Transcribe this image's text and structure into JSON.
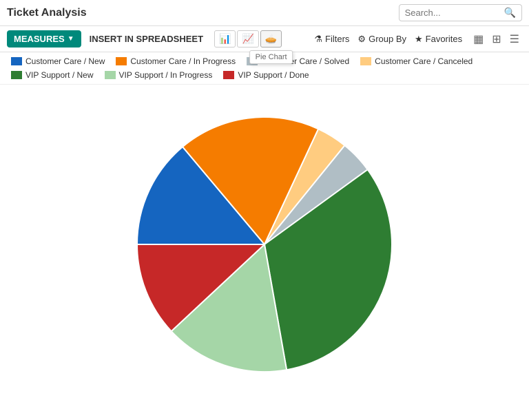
{
  "header": {
    "title": "Ticket Analysis",
    "search_placeholder": "Search..."
  },
  "toolbar": {
    "measures_label": "MEASURES",
    "insert_label": "INSERT IN SPREADSHEET",
    "filters_label": "Filters",
    "group_by_label": "Group By",
    "favorites_label": "Favorites"
  },
  "pie_tooltip_label": "Pie Chart",
  "legend": [
    {
      "label": "Customer Care / New",
      "color": "#1565c0"
    },
    {
      "label": "Customer Care / In Progress",
      "color": "#f57c00"
    },
    {
      "label": "Customer Care / Solved",
      "color": "#b0bec5"
    },
    {
      "label": "Customer Care / Canceled",
      "color": "#ffcc80"
    },
    {
      "label": "VIP Support / New",
      "color": "#2e7d32"
    },
    {
      "label": "VIP Support / In Progress",
      "color": "#a5d6a7"
    },
    {
      "label": "VIP Support / Done",
      "color": "#c62828"
    }
  ],
  "chart": {
    "segments": [
      {
        "label": "Customer Care / New",
        "color": "#1565c0",
        "percent": 14,
        "startAngle": -90,
        "endAngle": -39.6
      },
      {
        "label": "Customer Care / In Progress",
        "color": "#f57c00",
        "percent": 18,
        "startAngle": -39.6,
        "endAngle": 25.2
      },
      {
        "label": "Customer Care / Canceled",
        "color": "#ffcc80",
        "percent": 4,
        "startAngle": 25.2,
        "endAngle": 39.6
      },
      {
        "label": "Customer Care / Solved",
        "color": "#b0bec5",
        "percent": 4,
        "startAngle": 39.6,
        "endAngle": 54
      },
      {
        "label": "VIP Support / New",
        "color": "#2e7d32",
        "percent": 32,
        "startAngle": 54,
        "endAngle": 169.2
      },
      {
        "label": "VIP Support / In Progress",
        "color": "#a5d6a7",
        "percent": 16,
        "startAngle": 169.2,
        "endAngle": 226.8
      },
      {
        "label": "VIP Support / Done",
        "color": "#c62828",
        "percent": 12,
        "startAngle": 226.8,
        "endAngle": 270
      }
    ]
  }
}
